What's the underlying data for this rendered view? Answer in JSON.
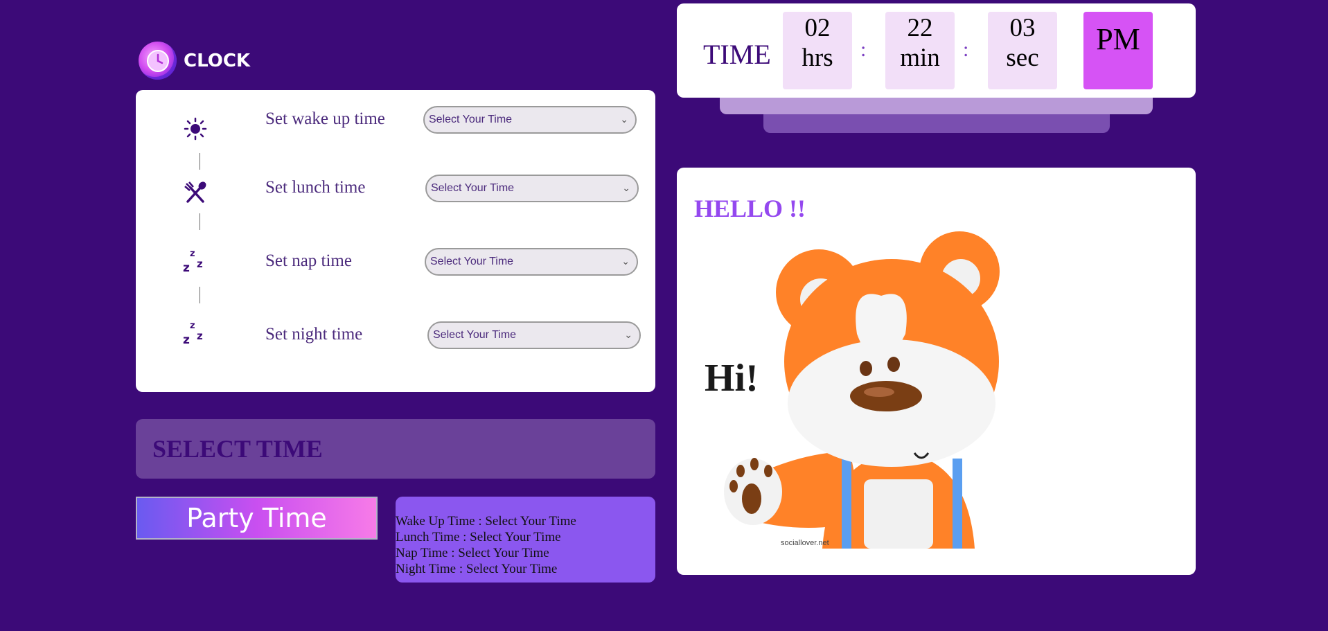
{
  "logo": {
    "text": "CLOCK",
    "icon": "clock-icon"
  },
  "schedule": {
    "rows": [
      {
        "label": "Set wake up time",
        "icon": "sun-icon",
        "select": "Select Your Time"
      },
      {
        "label": "Set lunch time",
        "icon": "fork-spoon-icon",
        "select": "Select Your Time"
      },
      {
        "label": "Set nap time",
        "icon": "sleep-icon",
        "select": "Select Your Time"
      },
      {
        "label": "Set night time",
        "icon": "sleep-icon",
        "select": "Select Your Time"
      }
    ]
  },
  "banner": {
    "text": "SELECT TIME"
  },
  "party_button": {
    "label": "Party Time"
  },
  "summary": {
    "lines": [
      "Wake Up Time : Select Your Time",
      "Lunch Time : Select Your Time",
      "Nap Time : Select Your Time",
      "Night Time : Select Your Time"
    ]
  },
  "clock": {
    "label": "TIME",
    "hours": "02",
    "hours_unit": "hrs",
    "minutes": "22",
    "minutes_unit": "min",
    "seconds": "03",
    "seconds_unit": "sec",
    "separator": ":",
    "ampm": "PM"
  },
  "hello": {
    "title": "HELLO !!",
    "image_text": "Hi!",
    "watermark": "sociallover.net"
  },
  "colors": {
    "background": "#3c0a78",
    "accent_purple": "#9448ef",
    "ampm_box": "#d653f5",
    "time_box": "#f2dff8"
  }
}
